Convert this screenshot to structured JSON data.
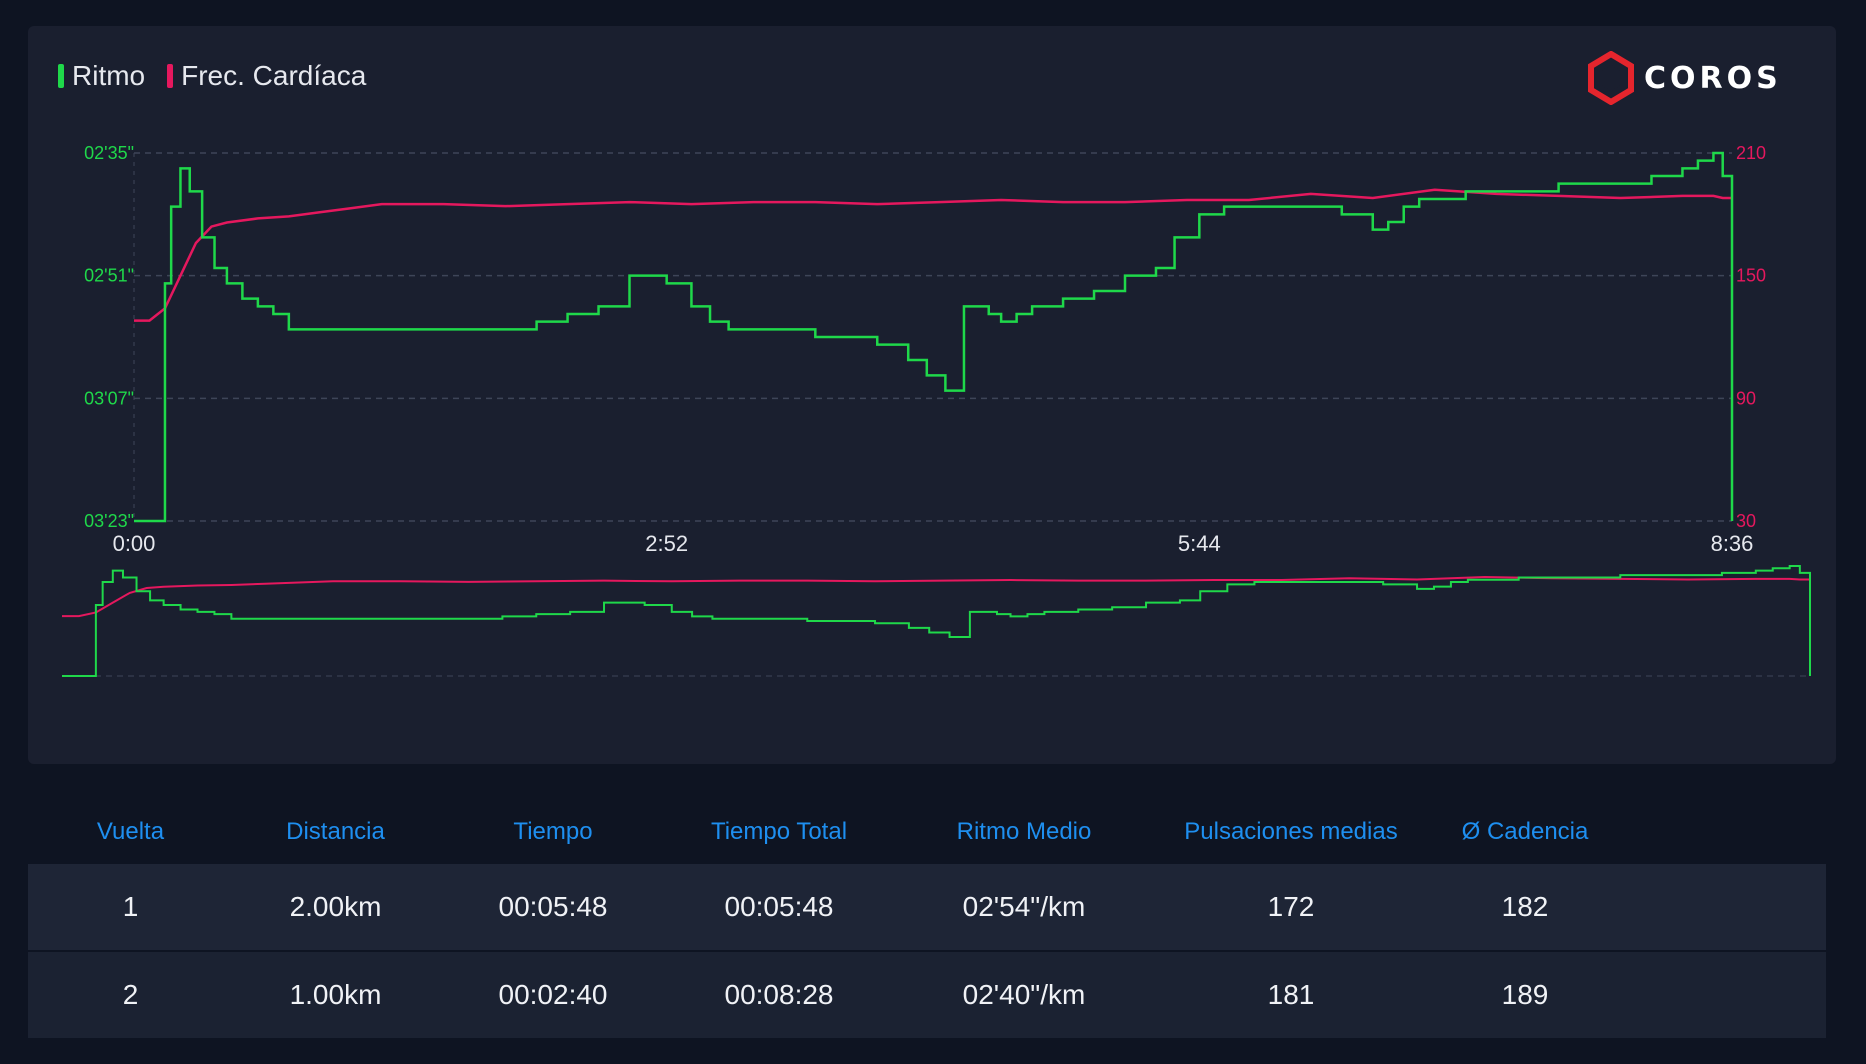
{
  "legend": {
    "pace_label": "Ritmo",
    "hr_label": "Frec. Cardíaca"
  },
  "logo": {
    "text": "COROS"
  },
  "colors": {
    "pace": "#1fd84a",
    "heart_rate": "#e5185e",
    "header_text": "#1e8ff0",
    "background": "#0e1422",
    "panel": "#1a1f2f"
  },
  "chart_data": {
    "type": "line",
    "x_tick_labels": [
      "0:00",
      "2:52",
      "5:44",
      "8:36"
    ],
    "x_ticks_seconds": [
      0,
      172,
      344,
      516
    ],
    "left_axis": {
      "tick_labels": [
        "02'35\"",
        "02'51\"",
        "03'07\"",
        "03'23\""
      ],
      "tick_seconds_per_km": [
        155,
        171,
        187,
        203
      ],
      "inverted": true
    },
    "right_axis": {
      "tick_labels": [
        "210",
        "150",
        "90",
        "30"
      ],
      "range": [
        30,
        210
      ]
    },
    "series": [
      {
        "name": "Ritmo",
        "axis": "left",
        "x": [
          0,
          6,
          10,
          12,
          15,
          18,
          22,
          26,
          30,
          35,
          40,
          45,
          50,
          55,
          60,
          70,
          80,
          90,
          100,
          110,
          120,
          130,
          140,
          150,
          160,
          165,
          172,
          180,
          186,
          192,
          200,
          210,
          220,
          240,
          250,
          256,
          262,
          268,
          272,
          276,
          280,
          285,
          290,
          300,
          310,
          320,
          330,
          336,
          344,
          348,
          352,
          356,
          362,
          370,
          380,
          390,
          400,
          405,
          410,
          415,
          420,
          430,
          440,
          450,
          460,
          470,
          480,
          490,
          500,
          505,
          510,
          513,
          516
        ],
        "values": [
          203,
          203,
          172,
          162,
          157,
          160,
          166,
          170,
          172,
          174,
          175,
          176,
          178,
          178,
          178,
          178,
          178,
          178,
          178,
          178,
          178,
          177,
          176,
          175,
          171,
          171,
          172,
          175,
          177,
          178,
          178,
          178,
          179,
          180,
          182,
          184,
          186,
          175,
          175,
          176,
          177,
          176,
          175,
          174,
          173,
          171,
          170,
          166,
          163,
          163,
          162,
          162,
          162,
          162,
          162,
          163,
          165,
          164,
          162,
          161,
          161,
          160,
          160,
          160,
          159,
          159,
          159,
          158,
          157,
          156,
          155,
          158,
          203
        ]
      },
      {
        "name": "Frec. Cardíaca",
        "axis": "right",
        "x": [
          0,
          5,
          10,
          15,
          20,
          25,
          30,
          40,
          50,
          60,
          70,
          80,
          100,
          120,
          140,
          160,
          180,
          200,
          220,
          240,
          260,
          280,
          300,
          320,
          340,
          360,
          380,
          400,
          420,
          440,
          460,
          480,
          500,
          510,
          513,
          516
        ],
        "values": [
          128,
          128,
          134,
          150,
          166,
          174,
          176,
          178,
          179,
          181,
          183,
          185,
          185,
          184,
          185,
          186,
          185,
          186,
          186,
          185,
          186,
          187,
          186,
          186,
          187,
          187,
          190,
          188,
          192,
          190,
          189,
          188,
          189,
          189,
          188,
          188
        ]
      }
    ],
    "has_overview_navigator": true,
    "grid": true,
    "legend_position": "top-left"
  },
  "table": {
    "headers": [
      "Vuelta",
      "Distancia",
      "Tiempo",
      "Tiempo Total",
      "Ritmo Medio",
      "Pulsaciones medias",
      "Ø Cadencia"
    ],
    "rows": [
      [
        "1",
        "2.00km",
        "00:05:48",
        "00:05:48",
        "02'54\"/km",
        "172",
        "182"
      ],
      [
        "2",
        "1.00km",
        "00:02:40",
        "00:08:28",
        "02'40\"/km",
        "181",
        "189"
      ]
    ]
  }
}
